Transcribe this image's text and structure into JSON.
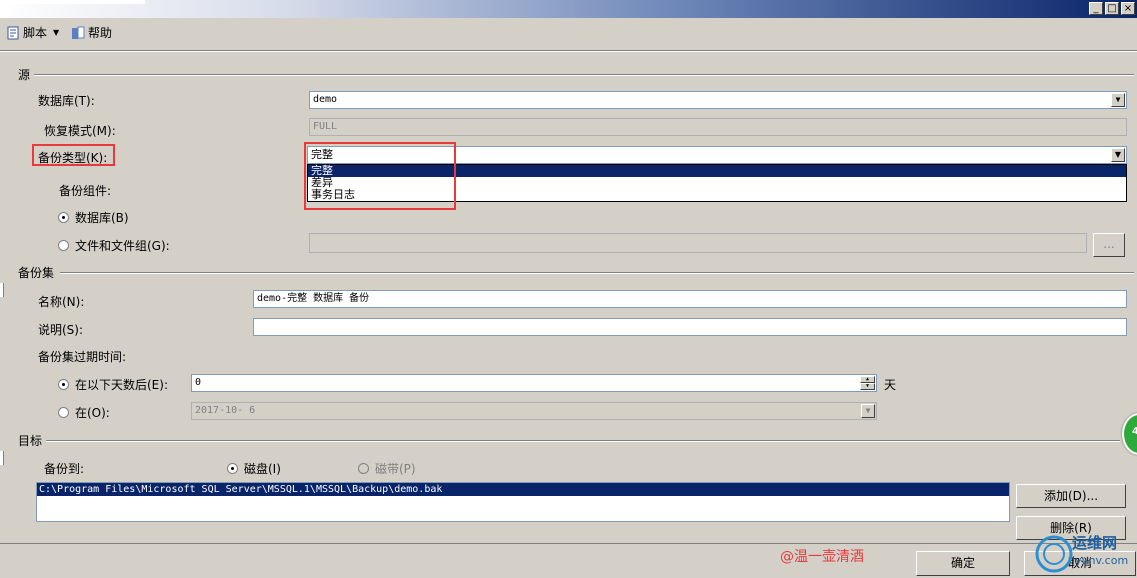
{
  "window": {
    "minimize": "_",
    "maximize": "□",
    "close": "×"
  },
  "toolbar": {
    "script_label": "脚本",
    "help_label": "帮助"
  },
  "source": {
    "group_title": "源",
    "database_label": "数据库(T):",
    "database_value": "demo",
    "recovery_label": "恢复模式(M):",
    "recovery_value": "FULL",
    "backup_type_label": "备份类型(K):",
    "backup_type_value": "完整",
    "backup_type_options": [
      "完整",
      "差异",
      "事务日志"
    ],
    "component_label": "备份组件:",
    "radio_database": "数据库(B)",
    "radio_files": "文件和文件组(G):",
    "browse_label": "..."
  },
  "backup_set": {
    "group_title": "备份集",
    "name_label": "名称(N):",
    "name_value": "demo-完整 数据库 备份",
    "desc_label": "说明(S):",
    "desc_value": "",
    "expire_label": "备份集过期时间:",
    "after_days_label": "在以下天数后(E):",
    "after_days_value": "0",
    "days_unit": "天",
    "on_label": "在(O):",
    "on_value": "2017-10- 6"
  },
  "destination": {
    "group_title": "目标",
    "backup_to_label": "备份到:",
    "disk_label": "磁盘(I)",
    "tape_label": "磁带(P)",
    "paths": [
      "C:\\Program Files\\Microsoft SQL Server\\MSSQL.1\\MSSQL\\Backup\\demo.bak"
    ],
    "add_label": "添加(D)...",
    "remove_label": "删除(R)"
  },
  "footer": {
    "ok_label": "确定",
    "cancel_label": "取消",
    "watermark": "@温一壶清酒",
    "logo_text": "运维网",
    "logo_sub": "iyunv.com",
    "badge_text": "4"
  },
  "colors": {
    "highlight": "#e83a3a",
    "selection": "#0a246a",
    "dialog": "#d4d0c8"
  }
}
